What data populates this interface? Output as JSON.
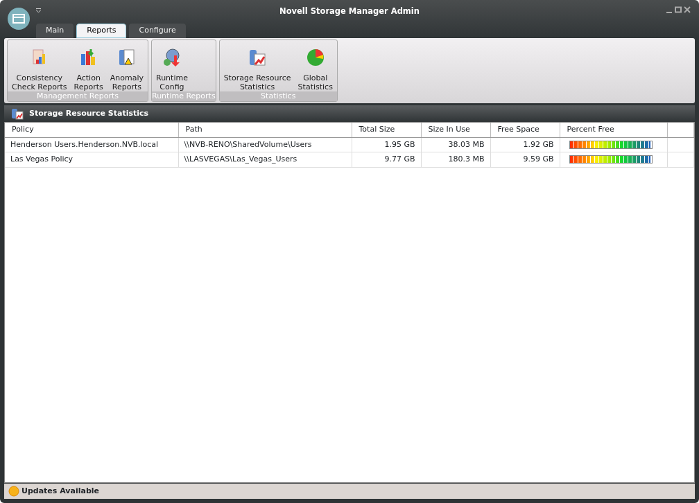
{
  "window": {
    "title": "Novell Storage Manager Admin"
  },
  "tabs": [
    {
      "label": "Main",
      "selected": false
    },
    {
      "label": "Reports",
      "selected": true
    },
    {
      "label": "Configure",
      "selected": false
    }
  ],
  "ribbon_groups": [
    {
      "title": "Management Reports",
      "items": [
        "Consistency\nCheck Reports",
        "Action\nReports",
        "Anomaly\nReports"
      ]
    },
    {
      "title": "Runtime Reports",
      "items": [
        "Runtime\nConfig"
      ]
    },
    {
      "title": "Statistics",
      "items": [
        "Storage Resource\nStatistics",
        "Global\nStatistics"
      ]
    }
  ],
  "panel": {
    "title": "Storage Resource Statistics"
  },
  "table": {
    "columns": [
      "Policy",
      "Path",
      "Total Size",
      "Size In Use",
      "Free Space",
      "Percent Free"
    ],
    "rows": [
      {
        "policy": "Henderson Users.Henderson.NVB.local",
        "path": "\\\\NVB-RENO\\SharedVolume\\Users",
        "total": "1.95 GB",
        "used": "38.03 MB",
        "free": "1.92 GB",
        "level": 0.98
      },
      {
        "policy": "Las Vegas Policy",
        "path": "\\\\LASVEGAS\\Las_Vegas_Users",
        "total": "9.77 GB",
        "used": "180.3 MB",
        "free": "9.59 GB",
        "level": 0.98
      }
    ]
  },
  "status_bar": {
    "text": "Updates Available"
  }
}
